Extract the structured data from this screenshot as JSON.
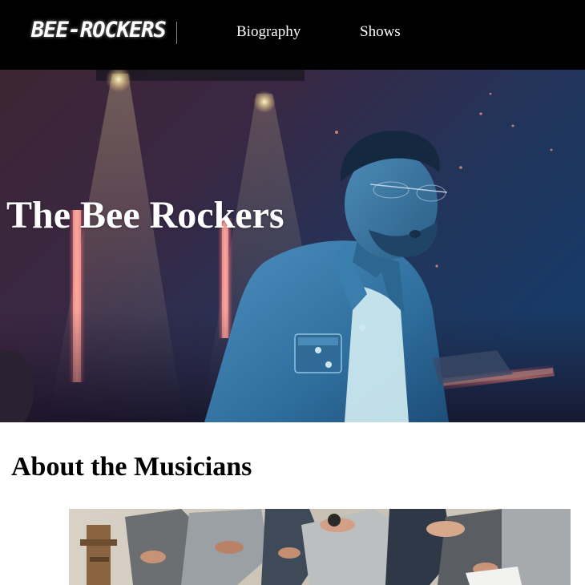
{
  "header": {
    "logo_text": "BEE-ROCKERS",
    "nav": [
      {
        "label": "Biography"
      },
      {
        "label": "Shows"
      }
    ]
  },
  "hero": {
    "title": "The Bee Rockers"
  },
  "about": {
    "heading": "About the Musicians"
  },
  "colors": {
    "header_bg": "#000000",
    "page_bg": "#ffffff",
    "text_light": "#ffffff",
    "text_dark": "#000000"
  }
}
